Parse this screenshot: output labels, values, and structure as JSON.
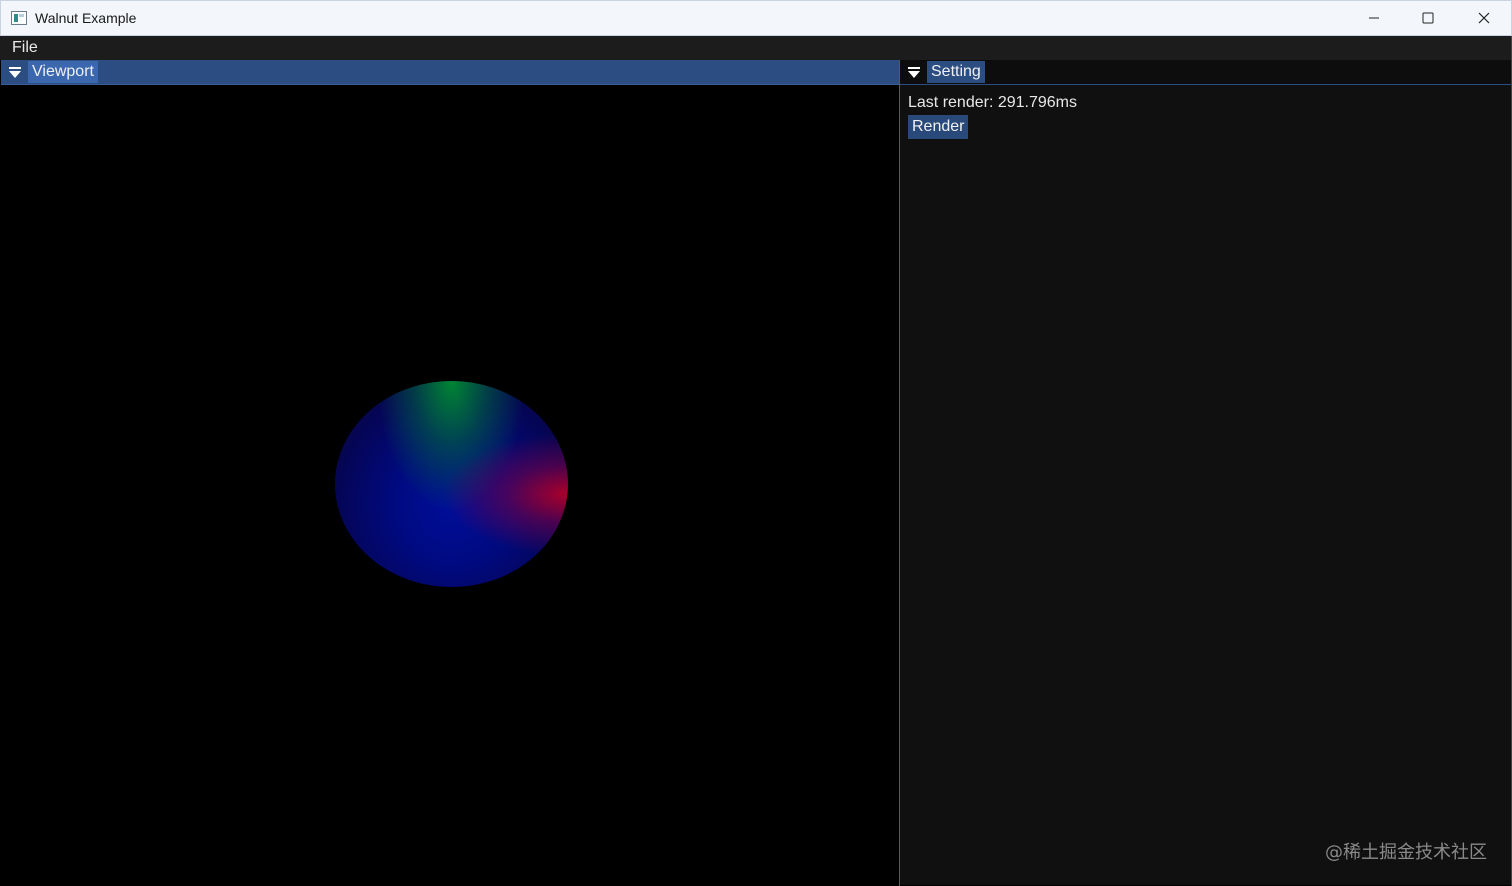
{
  "window": {
    "title": "Walnut Example"
  },
  "menu": {
    "file_label": "File"
  },
  "viewport_panel": {
    "tab_label": "Viewport"
  },
  "setting_panel": {
    "tab_label": "Setting",
    "last_render_text": "Last render: 291.796ms",
    "render_button_label": "Render"
  },
  "watermark": "@稀土掘金技术社区",
  "colors": {
    "active_tab": "#3a67ad",
    "header_blue": "#2c4d82",
    "panel_bg": "#101010",
    "menubar_bg": "#1c1c1c"
  },
  "icons": [
    "app-icon",
    "minimize-icon",
    "maximize-icon",
    "close-icon",
    "collapse-arrow-icon"
  ]
}
